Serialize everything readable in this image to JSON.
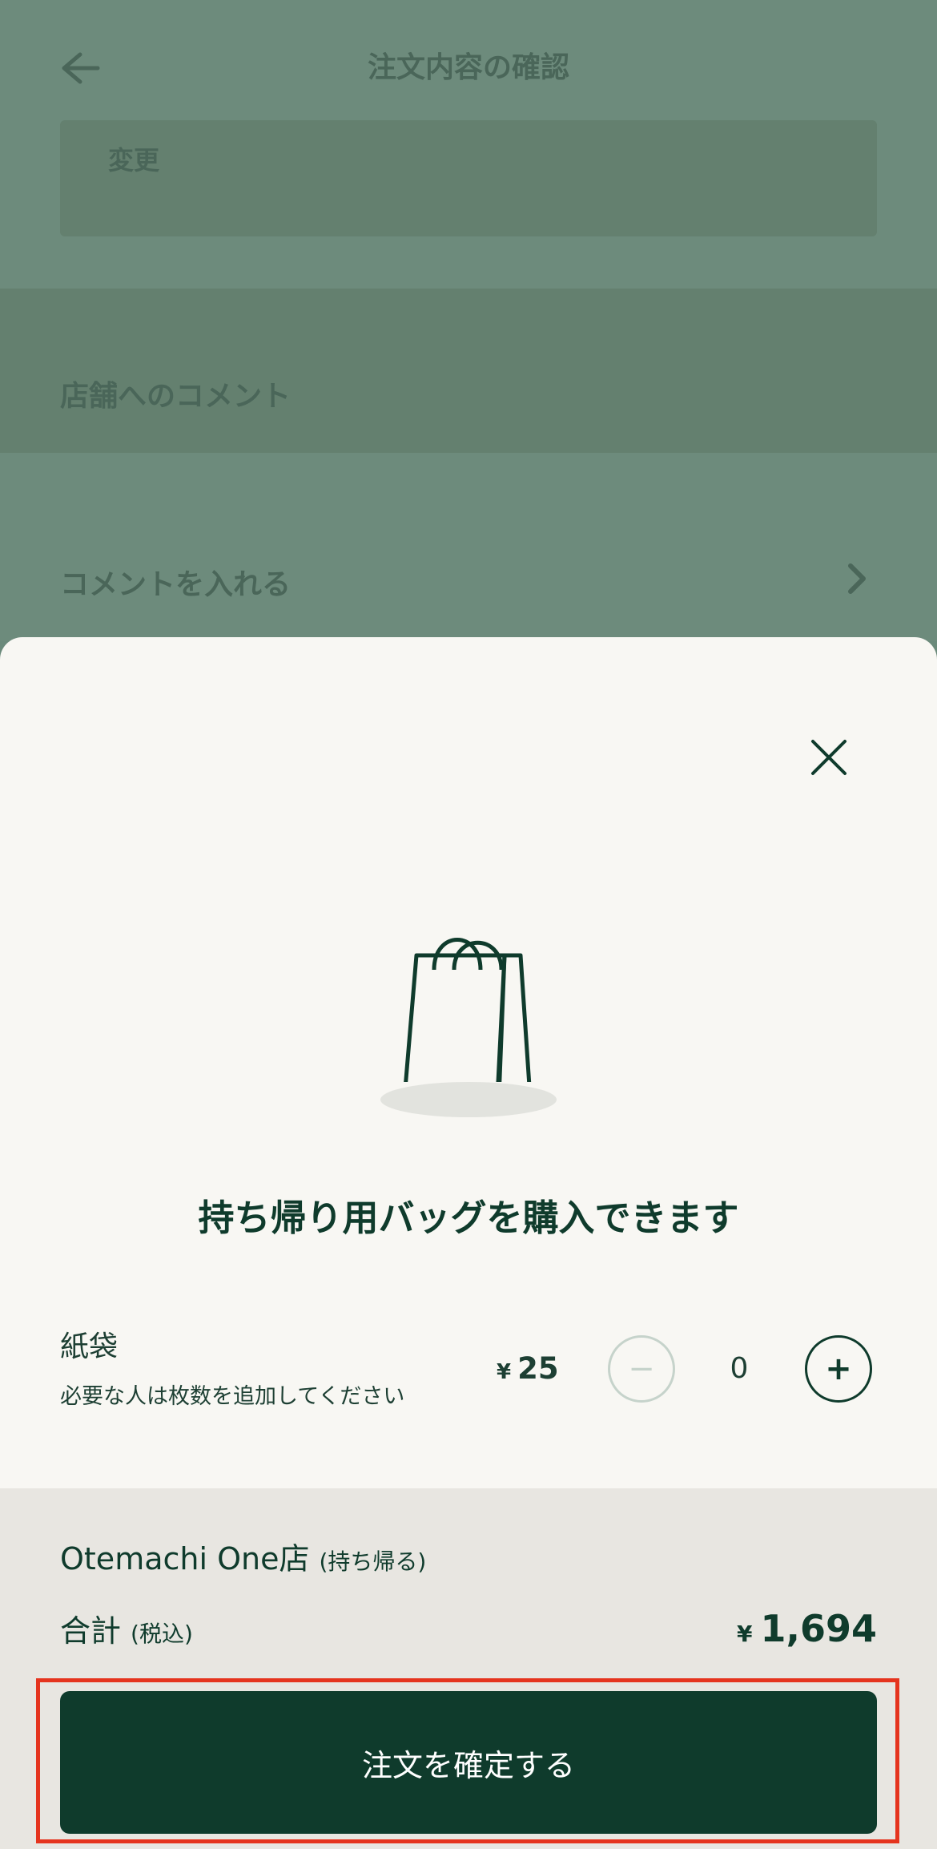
{
  "background": {
    "title": "注文内容の確認",
    "box_label": "変更",
    "section_label": "店舗へのコメント",
    "comment_row_label": "コメントを入れる"
  },
  "sheet": {
    "heading": "持ち帰り用バッグを購入できます",
    "item": {
      "name": "紙袋",
      "description": "必要な人は枚数を追加してください",
      "price_symbol": "¥",
      "price": "25",
      "quantity": "0",
      "minus_label": "−",
      "plus_label": "+"
    }
  },
  "footer": {
    "store_name": "Otemachi One店",
    "store_mode": "(持ち帰る)",
    "total_label": "合計",
    "total_tax": "(税込)",
    "total_symbol": "¥",
    "total_amount": "1,694",
    "confirm_label": "注文を確定する"
  },
  "colors": {
    "brand_dark_green": "#0f3b2c",
    "highlight_red": "#e5341e",
    "overlay_green": "#6d8b7c"
  },
  "icons": [
    "back-arrow-icon",
    "chevron-right-icon",
    "close-icon",
    "shopping-bag-icon"
  ]
}
